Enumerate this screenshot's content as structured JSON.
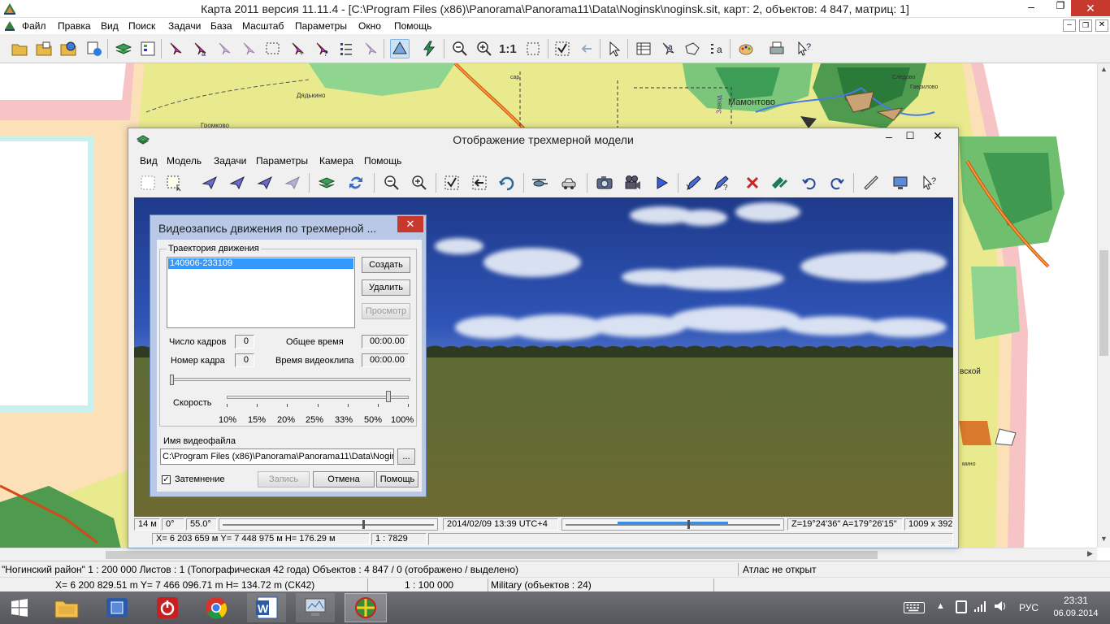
{
  "main_window": {
    "title": "Карта 2011 версия 11.11.4 - [C:\\Program Files (x86)\\Panorama\\Panorama11\\Data\\Noginsk\\noginsk.sit, карт: 2, объектов: 4 847, матриц: 1]",
    "menu": [
      "Файл",
      "Правка",
      "Вид",
      "Поиск",
      "Задачи",
      "База",
      "Масштаб",
      "Параметры",
      "Окно",
      "Помощь"
    ],
    "zoom_1to1": "1:1",
    "map_labels": {
      "mamontovo": "Мамонтово",
      "dyadkino": "Дядькино",
      "gromkovo": "Громково",
      "zavod": "Завод",
      "sledovo": "Следово",
      "gavrilovo": "Гаврилово",
      "vskoy": "вской",
      "mino": "мино",
      "sar": "сар"
    }
  },
  "status": {
    "row1": {
      "district": "\"Ногинский район\"  1 : 200 000  Листов : 1  (Топографическая 42 года)  Объектов : 4 847 / 0 (отображено / выделено)",
      "atlas": "Атлас не открыт"
    },
    "row2": {
      "coords": "X= 6 200 829.51 m  Y= 7 466 096.71 m  H=  134.72 m  (СК42)",
      "scale": "1 : 100 000",
      "layer": "Military   (объектов : 24)"
    }
  },
  "view3d": {
    "title": "Отображение трехмерной модели",
    "menu": [
      "Вид",
      "Модель",
      "Задачи",
      "Параметры",
      "Камера",
      "Помощь"
    ],
    "status": {
      "height": "14 м",
      "angle": "0°",
      "tilt": "55.0°",
      "datetime": "2014/02/09  13:39  UTC+4",
      "azimuth": "Z=19°24'36\"  A=179°26'15\"",
      "size": "1009 x 392",
      "coords": "X= 6 203 659 м  Y= 7 448 975 м  H= 176.29 м",
      "scale": "1 : 7829"
    }
  },
  "video_dialog": {
    "title": "Видеозапись движения по трехмерной ...",
    "trajectory_group": "Траектория движения",
    "trajectories": [
      "140906-233109"
    ],
    "btn_create": "Создать",
    "btn_delete": "Удалить",
    "btn_preview": "Просмотр",
    "frames_label": "Число кадров",
    "frames_value": "0",
    "total_time_label": "Общее время",
    "total_time_value": "00:00.00",
    "frame_no_label": "Номер кадра",
    "frame_no_value": "0",
    "clip_time_label": "Время видеоклипа",
    "clip_time_value": "00:00.00",
    "speed_label": "Скорость",
    "speed_ticks": [
      "10%",
      "15%",
      "20%",
      "25%",
      "33%",
      "50%",
      "100%"
    ],
    "speed_level": 0.9,
    "filename_label": "Имя видеофайла",
    "filename_value": "C:\\Program Files (x86)\\Panorama\\Panorama11\\Data\\Nogin",
    "browse": "...",
    "fade_label": "Затемнение",
    "fade_checked": true,
    "btn_record": "Запись",
    "btn_cancel": "Отмена",
    "btn_help": "Помощь"
  },
  "taskbar": {
    "lang": "РУС",
    "time": "23:31",
    "date": "06.09.2014"
  }
}
